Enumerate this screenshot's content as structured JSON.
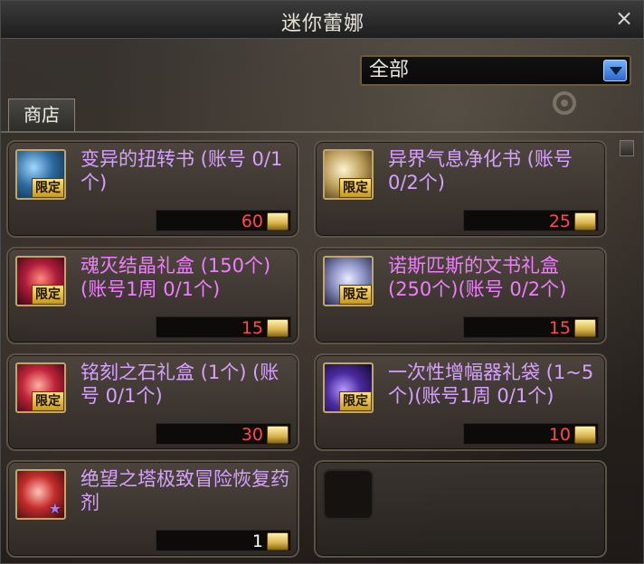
{
  "window": {
    "title": "迷你蕾娜",
    "close": "×"
  },
  "filter": {
    "selected": "全部"
  },
  "tabs": [
    {
      "label": "商店"
    }
  ],
  "items": [
    {
      "name": "变异的扭转书 (账号 0/1个)",
      "badge": "限定",
      "price": "60"
    },
    {
      "name": "异界气息净化书 (账号 0/2个)",
      "badge": "限定",
      "price": "25"
    },
    {
      "name": "魂灭结晶礼盒 (150个) (账号1周 0/1个)",
      "badge": "限定",
      "price": "15"
    },
    {
      "name": "诺斯匹斯的文书礼盒 (250个)(账号 0/2个)",
      "badge": "限定",
      "price": "15"
    },
    {
      "name": "铭刻之石礼盒 (1个) (账号 0/1个)",
      "badge": "限定",
      "price": "30"
    },
    {
      "name": "一次性增幅器礼袋 (1~5个)(账号1周 0/1个)",
      "badge": "限定",
      "price": "10"
    },
    {
      "name": "绝望之塔极致冒险恢复药剂",
      "badge": "",
      "price": "1"
    }
  ],
  "colors": {
    "name_purple": "#d6a0ff",
    "name_pink": "#f07cff",
    "price_red": "#ff4a4a",
    "price_white": "#ffffff"
  },
  "icons": {
    "close": "close-icon",
    "dropdown": "chevron-down-icon",
    "coin": "coin-icon",
    "star": "star-icon"
  }
}
